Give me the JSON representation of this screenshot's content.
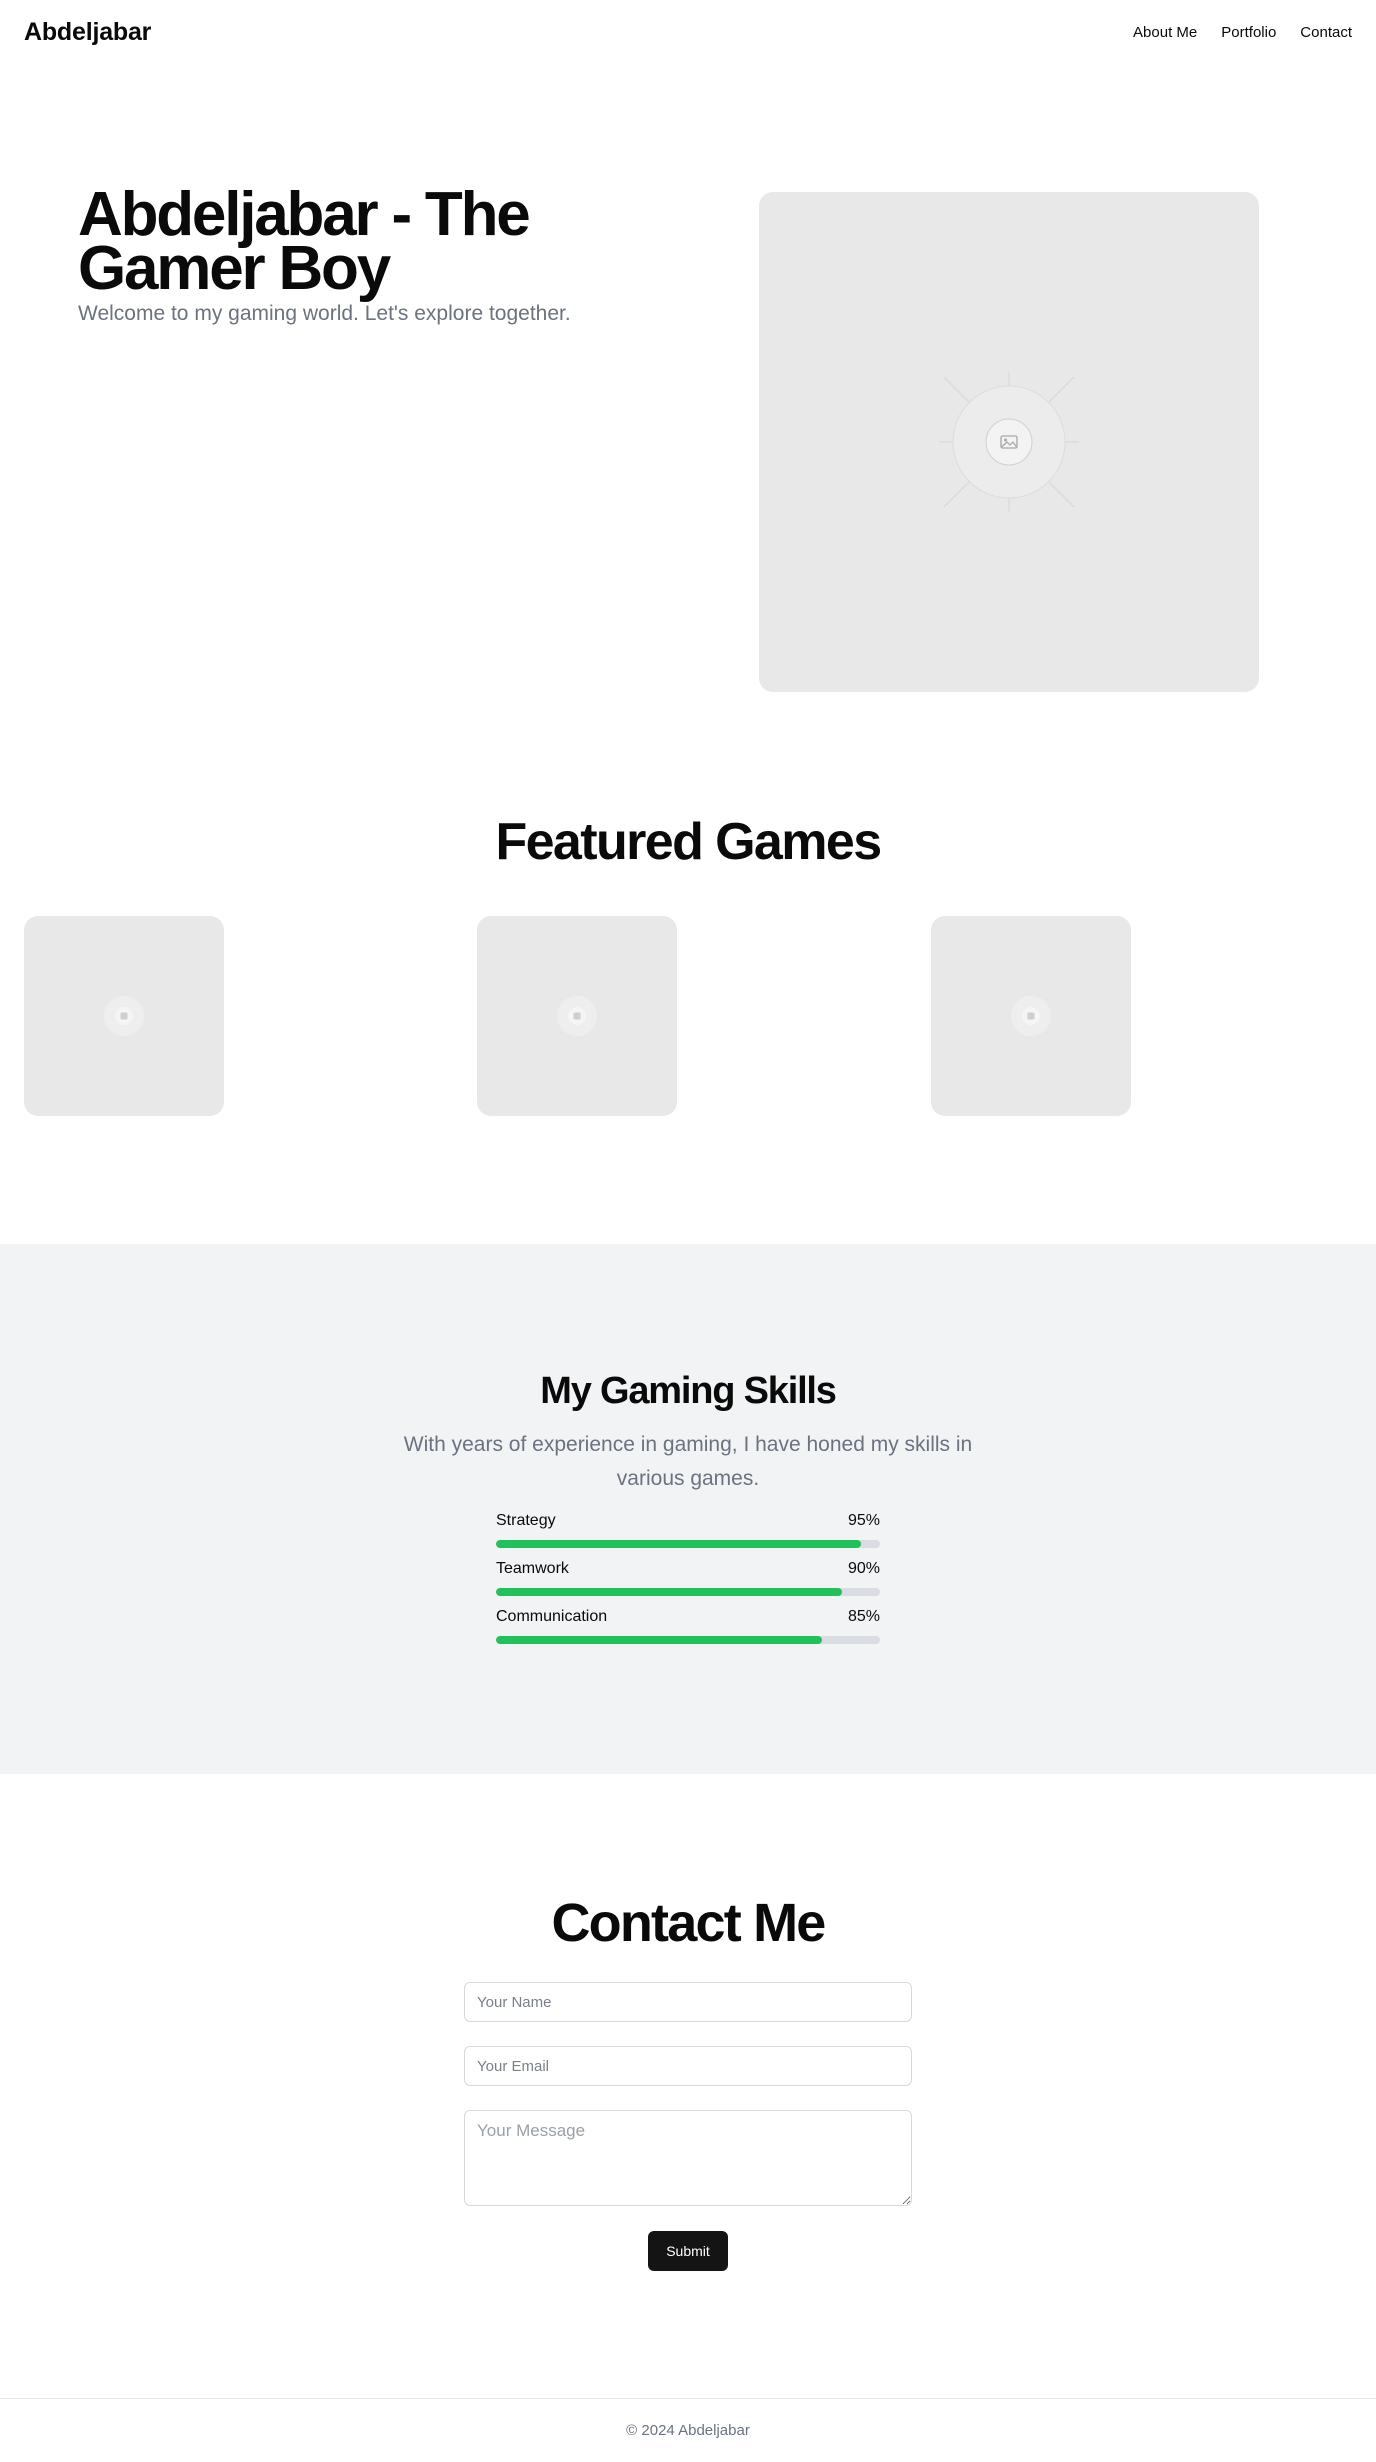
{
  "nav": {
    "brand": "Abdeljabar",
    "links": [
      "About Me",
      "Portfolio",
      "Contact"
    ]
  },
  "hero": {
    "title": "Abdeljabar - The Gamer Boy",
    "subtitle": "Welcome to my gaming world. Let's explore together.",
    "image_icon": "image-placeholder-icon"
  },
  "featured": {
    "title": "Featured Games",
    "cards": [
      {
        "icon": "image-placeholder-icon"
      },
      {
        "icon": "image-placeholder-icon"
      },
      {
        "icon": "image-placeholder-icon"
      }
    ]
  },
  "skills": {
    "title": "My Gaming Skills",
    "description": "With years of experience in gaming, I have honed my skills in various games.",
    "items": [
      {
        "name": "Strategy",
        "percent_label": "95%",
        "level": 95
      },
      {
        "name": "Teamwork",
        "percent_label": "90%",
        "level": 90
      },
      {
        "name": "Communication",
        "percent_label": "85%",
        "level": 85
      }
    ]
  },
  "contact": {
    "title": "Contact Me",
    "name_placeholder": "Your Name",
    "email_placeholder": "Your Email",
    "message_placeholder": "Your Message",
    "submit_label": "Submit"
  },
  "footer": {
    "copyright": "© 2024 Abdeljabar"
  },
  "colors": {
    "accent_green": "#22c05b",
    "placeholder_gray": "#e8e8e8",
    "section_bg": "#f2f3f5",
    "button_dark": "#141414"
  }
}
